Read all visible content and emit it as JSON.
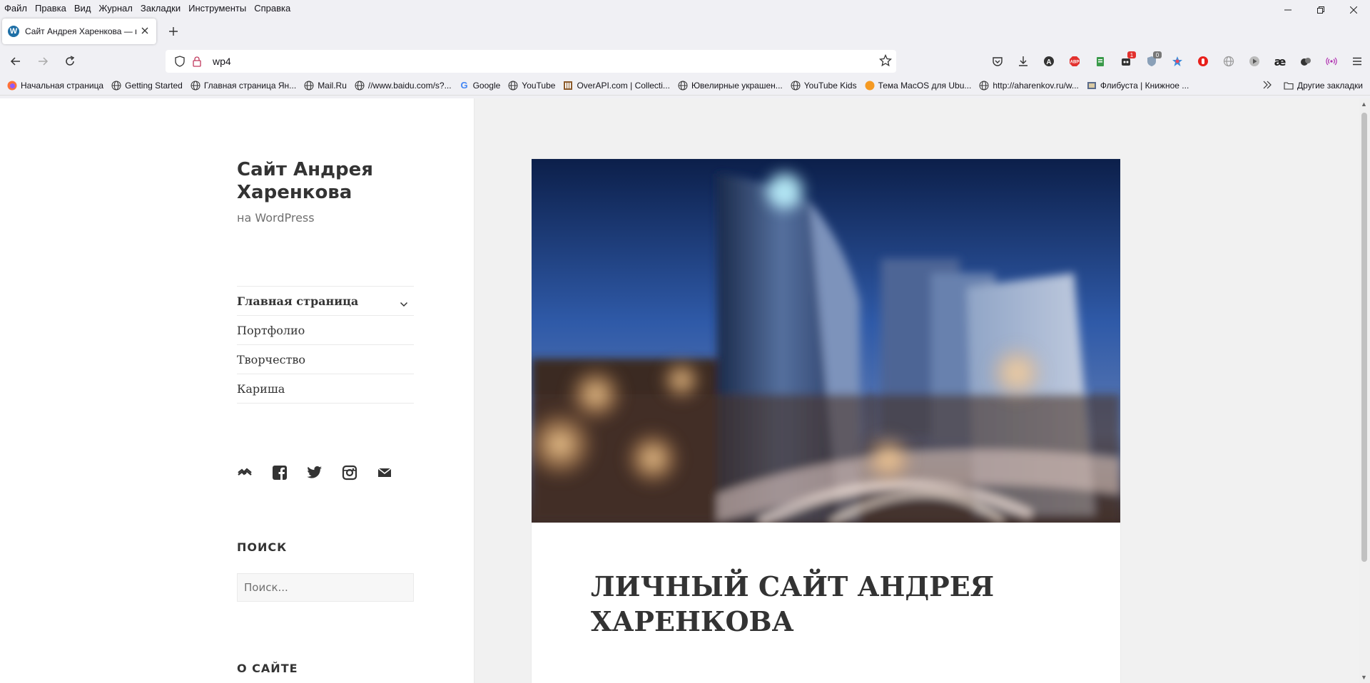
{
  "menubar": {
    "items": [
      "Файл",
      "Правка",
      "Вид",
      "Журнал",
      "Закладки",
      "Инструменты",
      "Справка"
    ]
  },
  "tab": {
    "title": "Сайт Андрея Харенкова — на",
    "favicon_letter": "W"
  },
  "urlbar": {
    "value": "wp4"
  },
  "bookmarks": {
    "items": [
      {
        "label": "Начальная страница",
        "icon": "firefox-icon"
      },
      {
        "label": "Getting Started",
        "icon": "globe-icon"
      },
      {
        "label": "Главная страница Ян...",
        "icon": "globe-icon"
      },
      {
        "label": "Mail.Ru",
        "icon": "globe-icon"
      },
      {
        "label": "//www.baidu.com/s?...",
        "icon": "globe-icon"
      },
      {
        "label": "Google",
        "icon": "google-icon"
      },
      {
        "label": "YouTube",
        "icon": "globe-icon"
      },
      {
        "label": "OverAPI.com | Collecti...",
        "icon": "overapi-icon"
      },
      {
        "label": "Ювелирные украшен...",
        "icon": "globe-icon"
      },
      {
        "label": "YouTube Kids",
        "icon": "globe-icon"
      },
      {
        "label": "Тема MacOS для Ubu...",
        "icon": "orange-circle-icon"
      },
      {
        "label": "http://aharenkov.ru/w...",
        "icon": "globe-icon"
      },
      {
        "label": "Флибуста | Книжное ...",
        "icon": "flibusta-icon"
      }
    ],
    "other": "Другие закладки"
  },
  "toolbar": {
    "badges": {
      "ext1": "1",
      "ext2": "0"
    }
  },
  "colors": {
    "accent_wp": "#1e6fa6",
    "page_bg": "#f1f1f1",
    "text": "#333333"
  },
  "site": {
    "title": "Сайт Андрея Харенкова",
    "description": "на WordPress"
  },
  "menu": {
    "items": [
      "Главная страница",
      "Портфолио",
      "Творчество",
      "Кариша"
    ]
  },
  "social": [
    "wordpress-icon",
    "facebook-icon",
    "twitter-icon",
    "instagram-icon",
    "mail-icon"
  ],
  "widgets": {
    "search_title": "ПОИСК",
    "search_placeholder": "Поиск...",
    "about_title": "О САЙТЕ"
  },
  "article": {
    "title": "ЛИЧНЫЙ САЙТ АНДРЕЯ ХАРЕНКОВА"
  }
}
